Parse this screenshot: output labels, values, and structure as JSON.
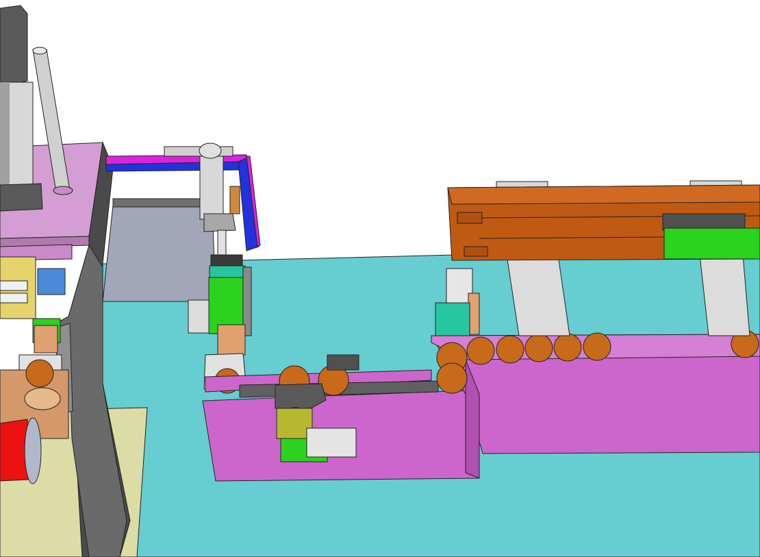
{
  "scene": {
    "cylinder_label": "",
    "slide_label": ""
  },
  "colors": {
    "floor": "#66cdd0",
    "pink_plate": "#d49ed4",
    "magenta_channel": "#cc66cc",
    "orange_rail": "#c05a12",
    "green_block": "#2bd21e",
    "teal_block": "#26c7a0",
    "gray_plate": "#a3a6b8",
    "roller": "#c86a1a",
    "red_cap": "#ee1111",
    "olive": "#b8b830",
    "dark_frame": "#5a5a5a"
  },
  "parts": {
    "conveyor_rollers_count": 8
  }
}
